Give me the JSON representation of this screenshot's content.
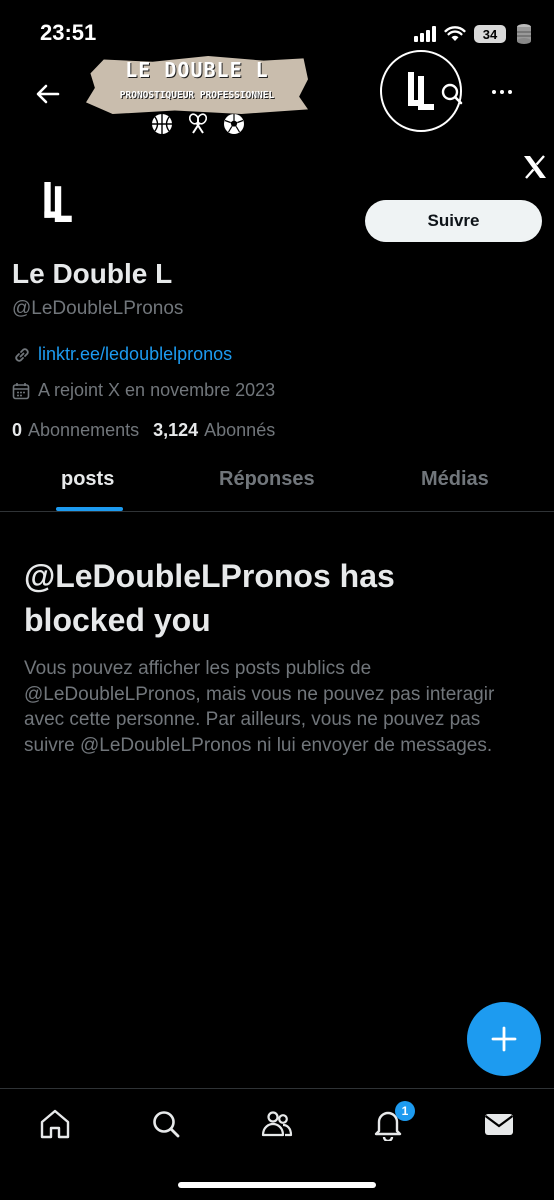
{
  "status_bar": {
    "time": "23:51",
    "battery": "34"
  },
  "header": {
    "banner_title": "LE DOUBLE L",
    "banner_subtitle": "PRONOSTIQUEUR PROFESSIONNEL",
    "icons": [
      "back-arrow-icon",
      "basketball-icon",
      "tennis-rackets-icon",
      "soccer-ball-icon",
      "search-icon",
      "more-icon",
      "x-logo-icon"
    ]
  },
  "profile": {
    "display_name": "Le Double L",
    "handle": "@LeDoubleLPronos",
    "link": "linktr.ee/ledoublelpronos",
    "joined": "A rejoint X en novembre 2023",
    "following_count": "0",
    "following_label": "Abonnements",
    "followers_count": "3,124",
    "followers_label": "Abonnés",
    "follow_label": "Suivre"
  },
  "tabs": [
    "posts",
    "Réponses",
    "Médias"
  ],
  "blocked": {
    "title": "@LeDoubleLPronos has blocked you",
    "description": "Vous pouvez afficher les posts publics de @LeDoubleLPronos, mais vous ne pouvez pas interagir avec cette personne. Par ailleurs, vous ne pouvez pas suivre @LeDoubleLPronos ni lui envoyer de messages."
  },
  "nav": {
    "items": [
      "home-icon",
      "search-icon",
      "communities-icon",
      "notifications-icon",
      "messages-icon"
    ],
    "notification_badge": "1"
  },
  "colors": {
    "accent": "#1d9bf0",
    "background": "#000000",
    "muted_text": "#71767b"
  }
}
